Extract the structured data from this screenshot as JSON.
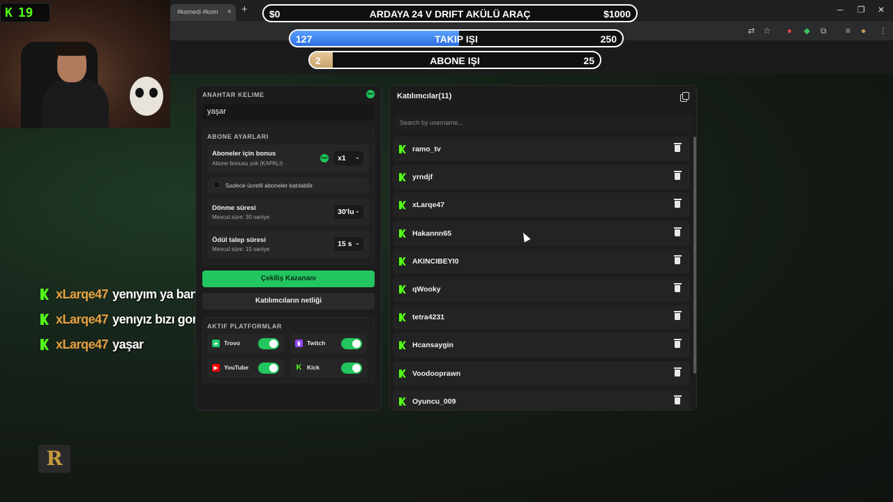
{
  "browser": {
    "tab_title": "#komedi #kom",
    "close_glyph": "×",
    "new_tab_glyph": "+",
    "minimize_glyph": "─",
    "maximize_glyph": "❐",
    "window_close_glyph": "✕"
  },
  "goals": {
    "main": {
      "left": "$0",
      "title": "ARDAYA 24 V DRIFT AKÜLÜ ARAÇ",
      "right": "$1000",
      "progress": 0.0
    },
    "follow": {
      "left": "127",
      "title": "TAKIP IŞI",
      "right": "250",
      "progress": 0.508
    },
    "sub": {
      "left": "2",
      "title": "ABONE IŞI",
      "right": "25",
      "progress": 0.08
    }
  },
  "webcam": {
    "counter": "19"
  },
  "chat": [
    {
      "user": "xLarqe47",
      "message": "yenıyım ya ban acıksın"
    },
    {
      "user": "xLarqe47",
      "message": "yenıyız bızı gorun"
    },
    {
      "user": "xLarqe47",
      "message": "yaşar"
    }
  ],
  "logo_badge": "R",
  "left_panel": {
    "keyword_title": "ANAHTAR KELIME",
    "keyword_value": "yaşar",
    "dot_label": "ben",
    "sub_settings_title": "ABONE AYARLARI",
    "bonus": {
      "title": "Aboneler için bonus",
      "subtitle": "Abone bonusu yok (KAPALI)",
      "value": "x1"
    },
    "paid_only_label": "Sadece ücretli aboneler katılabilir.",
    "spin": {
      "title": "Dönme süresi",
      "subtitle": "Mevcut süre: 30 saniye",
      "value": "30'lu"
    },
    "claim": {
      "title": "Ödül talep süresi",
      "subtitle": "Mevcut süre: 15 saniye",
      "value": "15 s"
    },
    "chevron": "⌄",
    "draw_button": "Çekiliş Kazananı",
    "clear_button": "Katılımcıların netliği",
    "platforms_title": "AKTIF PLATFORMLAR",
    "platforms": [
      {
        "name": "Trovo",
        "icon": "trovo-icon",
        "color": "#1fc96b",
        "enabled": true
      },
      {
        "name": "Twitch",
        "icon": "twitch-icon",
        "color": "#9146ff",
        "enabled": true
      },
      {
        "name": "YouTube",
        "icon": "youtube-icon",
        "color": "#ff0000",
        "enabled": true
      },
      {
        "name": "Kick",
        "icon": "kick-icon",
        "color": "#53fc18",
        "enabled": true
      }
    ]
  },
  "right_panel": {
    "title": "Katılımcılar(11)",
    "search_placeholder": "Search by username...",
    "participants": [
      "ramo_tv",
      "yrndjf",
      "xLarqe47",
      "Hakannn65",
      "AKINCIBEYI0",
      "qWooky",
      "tetra4231",
      "Hcansaygin",
      "Voodooprawn",
      "Oyuncu_009"
    ]
  },
  "colors": {
    "accent_green": "#22c55e",
    "kick_green": "#53fc18",
    "follow_bar": "#2c6fe0",
    "sub_bar": "#c8a46a",
    "chat_user": "#e8a040"
  }
}
